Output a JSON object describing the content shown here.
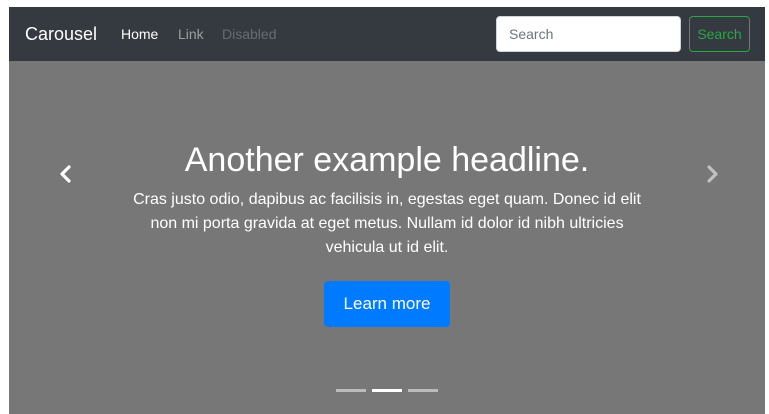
{
  "navbar": {
    "brand": "Carousel",
    "links": [
      {
        "label": "Home",
        "state": "active"
      },
      {
        "label": "Link",
        "state": "normal"
      },
      {
        "label": "Disabled",
        "state": "disabled"
      }
    ],
    "search": {
      "placeholder": "Search",
      "value": "",
      "button_label": "Search"
    }
  },
  "carousel": {
    "slide": {
      "headline": "Another example headline.",
      "lead": "Cras justo odio, dapibus ac facilisis in, egestas eget quam. Donec id elit non mi porta gravida at eget metus. Nullam id dolor id nibh ultricies vehicula ut id elit.",
      "button_label": "Learn more"
    },
    "prev_icon": "chevron-left-icon",
    "next_icon": "chevron-right-icon",
    "indicators": [
      {
        "active": false
      },
      {
        "active": true
      },
      {
        "active": false
      }
    ]
  },
  "colors": {
    "navbar_bg": "#343a40",
    "slide_bg": "#777777",
    "primary": "#007bff",
    "success": "#28a745"
  }
}
